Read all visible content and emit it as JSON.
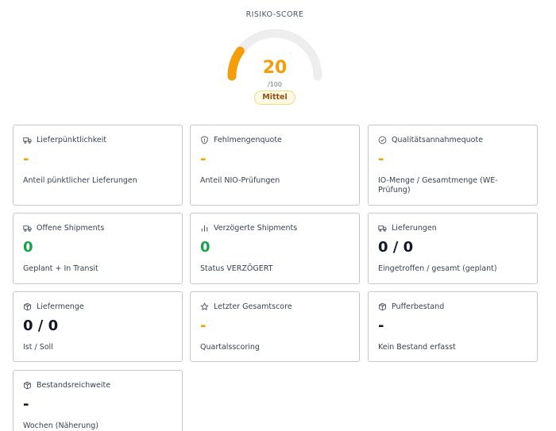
{
  "risk": {
    "title": "RISIKO-SCORE",
    "score": "20",
    "score_fraction": 0.2,
    "max": "/100",
    "level": "Mittel",
    "accent_color": "#f59e0b",
    "track_color": "#eeeeee"
  },
  "cards": [
    {
      "icon": "truck-icon",
      "label": "Lieferpünktlichkeit",
      "value": "-",
      "value_color": "orange",
      "description": "Anteil pünktlicher Lieferungen"
    },
    {
      "icon": "shield-icon",
      "label": "Fehlmengenquote",
      "value": "-",
      "value_color": "orange",
      "description": "Anteil NIO-Prüfungen"
    },
    {
      "icon": "check-circle-icon",
      "label": "Qualitätsannahmequote",
      "value": "-",
      "value_color": "orange",
      "description": "IO-Menge / Gesamtmenge (WE-Prüfung)"
    },
    {
      "icon": "truck-icon",
      "label": "Offene Shipments",
      "value": "0",
      "value_color": "green",
      "description": "Geplant + In Transit"
    },
    {
      "icon": "bar-chart-icon",
      "label": "Verzögerte Shipments",
      "value": "0",
      "value_color": "green",
      "description": "Status VERZÖGERT"
    },
    {
      "icon": "truck-icon",
      "label": "Lieferungen",
      "value": "0 / 0",
      "value_color": "dark",
      "description": "Eingetroffen / gesamt (geplant)"
    },
    {
      "icon": "package-icon",
      "label": "Liefermenge",
      "value": "0 / 0",
      "value_color": "dark",
      "description": "Ist / Soll"
    },
    {
      "icon": "star-icon",
      "label": "Letzter Gesamtscore",
      "value": "-",
      "value_color": "orange",
      "description": "Quartalsscoring"
    },
    {
      "icon": "package-icon",
      "label": "Pufferbestand",
      "value": "-",
      "value_color": "dark",
      "description": "Kein Bestand erfasst"
    },
    {
      "icon": "package-icon",
      "label": "Bestandsreichweite",
      "value": "-",
      "value_color": "dark",
      "description": "Wochen (Näherung)"
    }
  ]
}
